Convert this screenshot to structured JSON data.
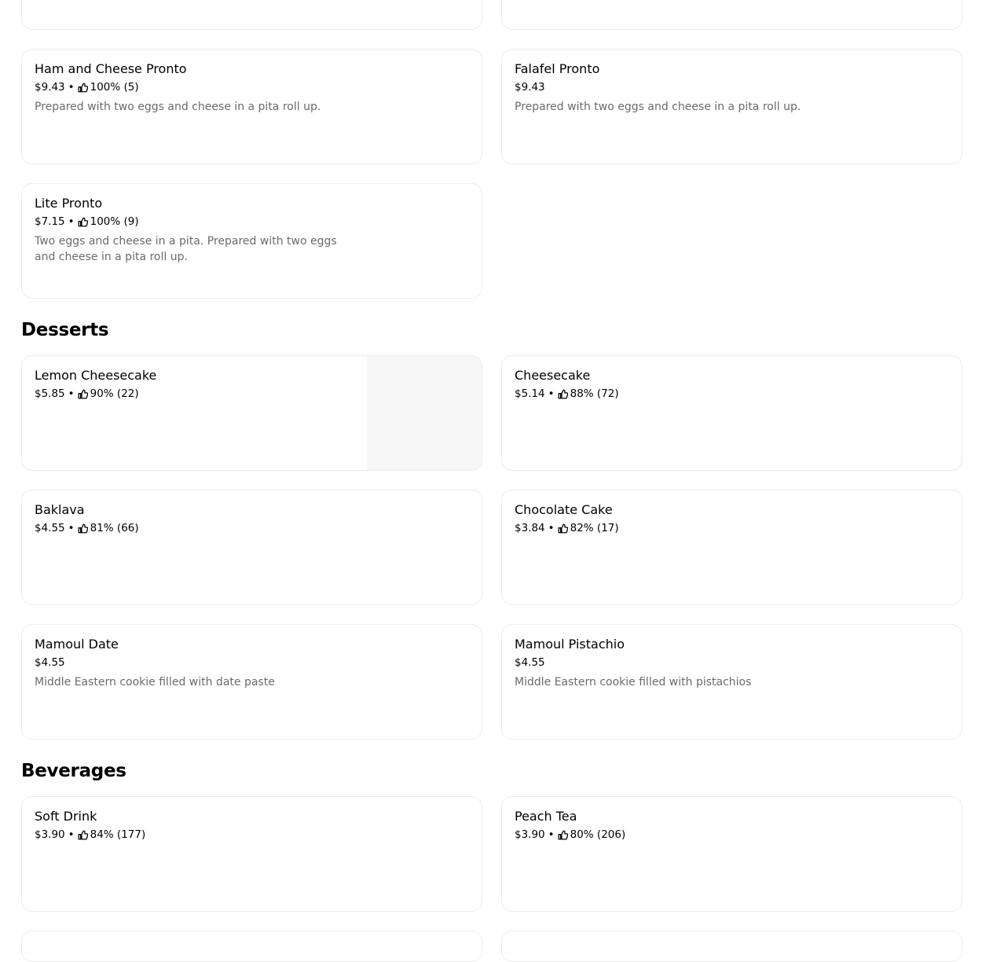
{
  "colors": {
    "card_border": "#ececec",
    "description": "#6b6b6b",
    "image_placeholder": "#f7f7f7"
  },
  "icons": {
    "rating": "thumbs-up-icon"
  },
  "sections": {
    "desserts": {
      "title": "Desserts"
    },
    "beverages": {
      "title": "Beverages"
    }
  },
  "items": {
    "ham_cheese": {
      "name": "Ham and Cheese Pronto",
      "price": "$9.43",
      "rating": "100% (5)",
      "description": "Prepared with two eggs and cheese in a pita roll up."
    },
    "falafel": {
      "name": "Falafel Pronto",
      "price": "$9.43",
      "description": "Prepared with two eggs and cheese in a pita roll up."
    },
    "lite": {
      "name": "Lite Pronto",
      "price": "$7.15",
      "rating": "100% (9)",
      "description": "Two eggs and cheese in a pita. Prepared with two eggs and cheese in a pita roll up."
    },
    "lemon_cheesecake": {
      "name": "Lemon Cheesecake",
      "price": "$5.85",
      "rating": "90% (22)"
    },
    "cheesecake": {
      "name": "Cheesecake",
      "price": "$5.14",
      "rating": "88% (72)"
    },
    "baklava": {
      "name": "Baklava",
      "price": "$4.55",
      "rating": "81% (66)"
    },
    "chocolate_cake": {
      "name": "Chocolate Cake",
      "price": "$3.84",
      "rating": "82% (17)"
    },
    "mamoul_date": {
      "name": "Mamoul Date",
      "price": "$4.55",
      "description": "Middle Eastern cookie filled with date paste"
    },
    "mamoul_pistachio": {
      "name": "Mamoul Pistachio",
      "price": "$4.55",
      "description": "Middle Eastern cookie filled with pistachios"
    },
    "soft_drink": {
      "name": "Soft Drink",
      "price": "$3.90",
      "rating": "84% (177)"
    },
    "peach_tea": {
      "name": "Peach Tea",
      "price": "$3.90",
      "rating": "80% (206)"
    }
  }
}
